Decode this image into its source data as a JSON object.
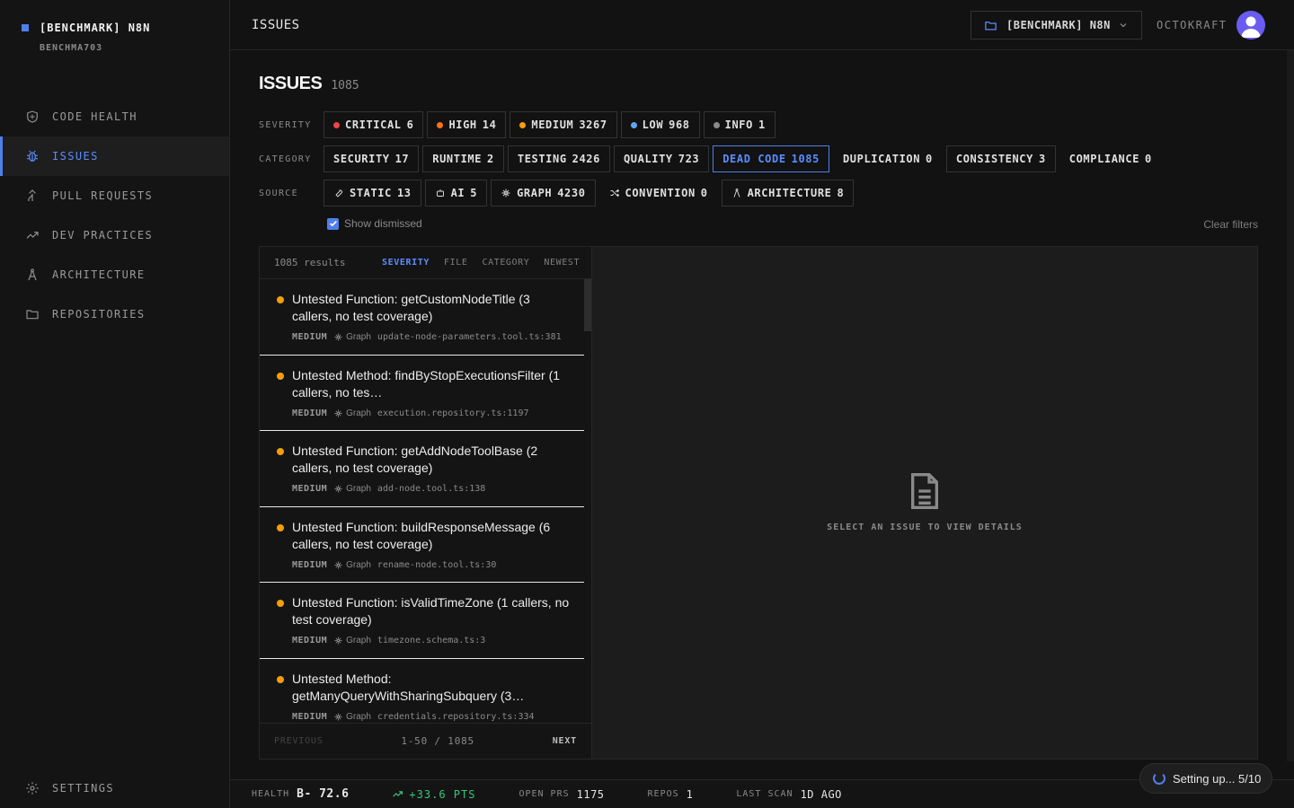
{
  "brand": {
    "name": "[BENCHMARK] N8N",
    "sub": "BENCHMA703",
    "accent": "#4f7fe8"
  },
  "nav": {
    "items": [
      {
        "label": "CODE HEALTH",
        "icon": "shield-icon"
      },
      {
        "label": "ISSUES",
        "icon": "bug-icon"
      },
      {
        "label": "PULL REQUESTS",
        "icon": "merge-icon"
      },
      {
        "label": "DEV PRACTICES",
        "icon": "trending-up-icon"
      },
      {
        "label": "ARCHITECTURE",
        "icon": "compass-icon"
      },
      {
        "label": "REPOSITORIES",
        "icon": "folder-icon"
      }
    ],
    "settings": "SETTINGS"
  },
  "topbar": {
    "title": "ISSUES",
    "repo": "[BENCHMARK] N8N",
    "org": "OCTOKRAFT"
  },
  "page": {
    "title": "ISSUES",
    "count": "1085"
  },
  "filters": {
    "severity_label": "SEVERITY",
    "severity": [
      {
        "label": "CRITICAL",
        "count": "6",
        "color": "#ef4444"
      },
      {
        "label": "HIGH",
        "count": "14",
        "color": "#f97316"
      },
      {
        "label": "MEDIUM",
        "count": "3267",
        "color": "#f59e0b"
      },
      {
        "label": "LOW",
        "count": "968",
        "color": "#60a5fa"
      },
      {
        "label": "INFO",
        "count": "1",
        "color": "#8a8a8a"
      }
    ],
    "category_label": "CATEGORY",
    "category": [
      {
        "label": "SECURITY",
        "count": "17"
      },
      {
        "label": "RUNTIME",
        "count": "2"
      },
      {
        "label": "TESTING",
        "count": "2426"
      },
      {
        "label": "QUALITY",
        "count": "723"
      },
      {
        "label": "DEAD CODE",
        "count": "1085"
      },
      {
        "label": "DUPLICATION",
        "count": "0"
      },
      {
        "label": "CONSISTENCY",
        "count": "3"
      },
      {
        "label": "COMPLIANCE",
        "count": "0"
      }
    ],
    "source_label": "SOURCE",
    "source": [
      {
        "label": "STATIC",
        "count": "13",
        "icon": "wrench-icon"
      },
      {
        "label": "AI",
        "count": "5",
        "icon": "robot-icon"
      },
      {
        "label": "GRAPH",
        "count": "4230",
        "icon": "graph-icon"
      },
      {
        "label": "CONVENTION",
        "count": "0",
        "icon": "shuffle-icon"
      },
      {
        "label": "ARCHITECTURE",
        "count": "8",
        "icon": "compass-icon"
      }
    ],
    "show_dismissed": "Show dismissed",
    "clear": "Clear filters"
  },
  "list": {
    "results": "1085 results",
    "sorts": [
      "SEVERITY",
      "FILE",
      "CATEGORY",
      "NEWEST"
    ],
    "items": [
      {
        "title": "Untested Function: getCustomNodeTitle (3 callers, no test coverage)",
        "severity": "MEDIUM",
        "source": "Graph",
        "file": "update-node-parameters.tool.ts:381"
      },
      {
        "title": "Untested Method: findByStopExecutionsFilter (1 callers, no tes…",
        "severity": "MEDIUM",
        "source": "Graph",
        "file": "execution.repository.ts:1197"
      },
      {
        "title": "Untested Function: getAddNodeToolBase (2 callers, no test coverage)",
        "severity": "MEDIUM",
        "source": "Graph",
        "file": "add-node.tool.ts:138"
      },
      {
        "title": "Untested Function: buildResponseMessage (6 callers, no test coverage)",
        "severity": "MEDIUM",
        "source": "Graph",
        "file": "rename-node.tool.ts:30"
      },
      {
        "title": "Untested Function: isValidTimeZone (1 callers, no test coverage)",
        "severity": "MEDIUM",
        "source": "Graph",
        "file": "timezone.schema.ts:3"
      },
      {
        "title": "Untested Method: getManyQueryWithSharingSubquery (3…",
        "severity": "MEDIUM",
        "source": "Graph",
        "file": "credentials.repository.ts:334"
      }
    ],
    "prev": "PREVIOUS",
    "page": "1-50 / 1085",
    "next": "NEXT"
  },
  "detail": {
    "empty": "SELECT AN ISSUE TO VIEW DETAILS"
  },
  "status": {
    "health_label": "HEALTH",
    "health": "B- 72.6",
    "delta": "+33.6 PTS",
    "prs_label": "OPEN PRS",
    "prs": "1175",
    "repos_label": "REPOS",
    "repos": "1",
    "scan_label": "LAST SCAN",
    "scan": "1D AGO",
    "toast": "Setting up... 5/10"
  }
}
